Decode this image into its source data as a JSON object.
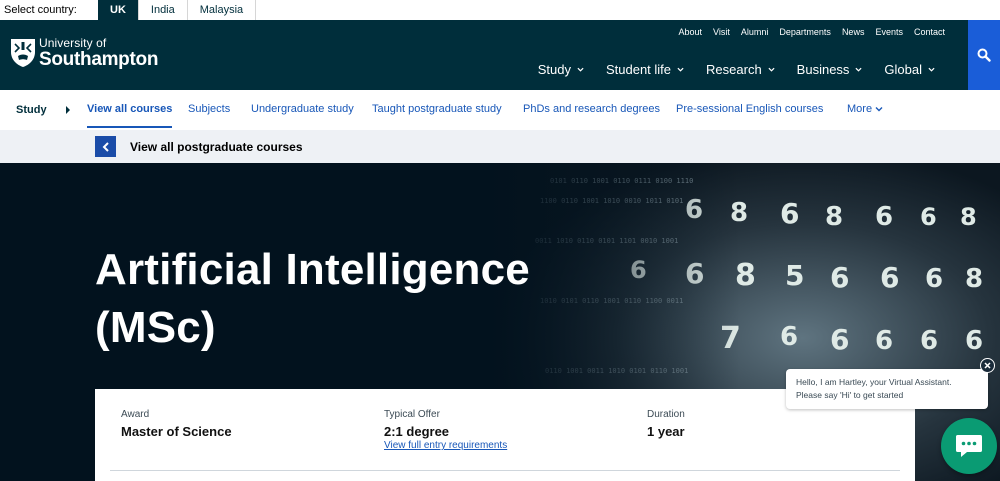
{
  "country_bar": {
    "label": "Select country:",
    "tabs": [
      {
        "label": "UK",
        "active": true
      },
      {
        "label": "India",
        "active": false
      },
      {
        "label": "Malaysia",
        "active": false
      }
    ]
  },
  "header": {
    "logo": {
      "line1": "University of",
      "line2": "Southampton"
    },
    "utility_nav": [
      "About",
      "Visit",
      "Alumni",
      "Departments",
      "News",
      "Events",
      "Contact"
    ],
    "main_nav": [
      "Study",
      "Student life",
      "Research",
      "Business",
      "Global"
    ],
    "search_icon": "search-icon",
    "colors": {
      "header_bg": "#002e3b",
      "search_bg": "#1a5dd8"
    }
  },
  "sub_nav": {
    "section": "Study",
    "links": [
      {
        "label": "View all courses",
        "active": true
      },
      {
        "label": "Subjects",
        "active": false
      },
      {
        "label": "Undergraduate study",
        "active": false
      },
      {
        "label": "Taught postgraduate study",
        "active": false
      },
      {
        "label": "PhDs and research degrees",
        "active": false
      },
      {
        "label": "Pre-sessional English courses",
        "active": false
      }
    ],
    "more_label": "More"
  },
  "back_bar": {
    "label": "View all postgraduate courses"
  },
  "hero": {
    "title_line1": "Artificial Intelligence",
    "title_line2": "(MSc)"
  },
  "info_card": {
    "award_label": "Award",
    "award_value": "Master of Science",
    "offer_label": "Typical Offer",
    "offer_value": "2:1 degree",
    "offer_link": "View full entry requirements",
    "duration_label": "Duration",
    "duration_value": "1 year"
  },
  "chat": {
    "message": "Hello, I am Hartley, your Virtual Assistant. Please say 'Hi' to get started",
    "launcher_icon": "chat-icon",
    "close_icon": "close-icon",
    "accent": "#0a9b73"
  }
}
